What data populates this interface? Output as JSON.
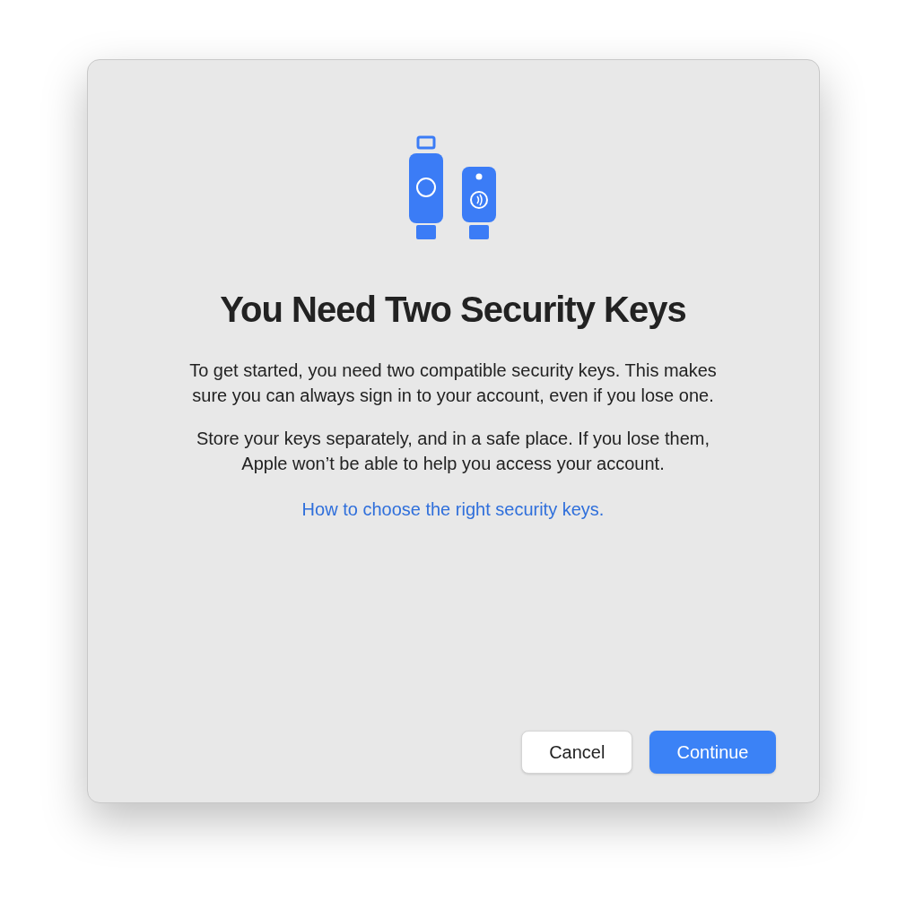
{
  "dialog": {
    "title": "You Need Two Security Keys",
    "paragraphs": [
      "To get started, you need two compatible security keys. This makes sure you can always sign in to your account, even if you lose one.",
      "Store your keys separately, and in a safe place. If you lose them, Apple won’t be able to help you access your account."
    ],
    "link": "How to choose the right security keys.",
    "buttons": [
      {
        "label": "Cancel",
        "kind": "secondary"
      },
      {
        "label": "Continue",
        "kind": "primary"
      }
    ]
  }
}
